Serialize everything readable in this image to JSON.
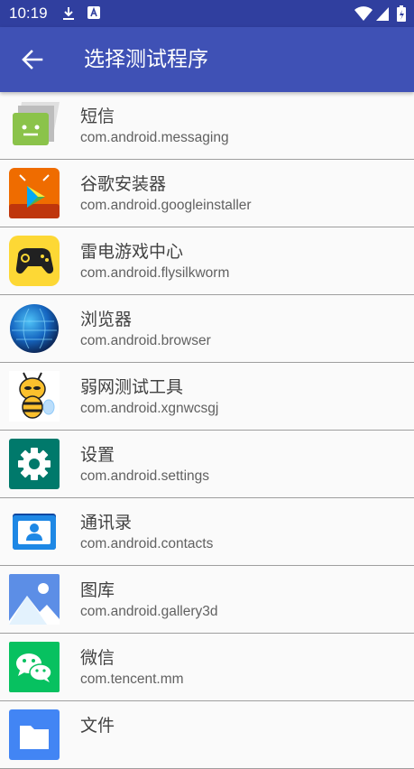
{
  "status_bar": {
    "time": "10:19"
  },
  "app_bar": {
    "title": "选择测试程序"
  },
  "apps": [
    {
      "name": "短信",
      "package": "com.android.messaging",
      "icon": "messaging-icon"
    },
    {
      "name": "谷歌安装器",
      "package": "com.android.googleinstaller",
      "icon": "google-installer-icon"
    },
    {
      "name": "雷电游戏中心",
      "package": "com.android.flysilkworm",
      "icon": "gamepad-icon"
    },
    {
      "name": "浏览器",
      "package": "com.android.browser",
      "icon": "globe-icon"
    },
    {
      "name": "弱网测试工具",
      "package": "com.android.xgnwcsgj",
      "icon": "bee-icon"
    },
    {
      "name": "设置",
      "package": "com.android.settings",
      "icon": "gear-icon"
    },
    {
      "name": "通讯录",
      "package": "com.android.contacts",
      "icon": "contacts-icon"
    },
    {
      "name": "图库",
      "package": "com.android.gallery3d",
      "icon": "gallery-icon"
    },
    {
      "name": "微信",
      "package": "com.tencent.mm",
      "icon": "wechat-icon"
    },
    {
      "name": "文件",
      "package": "",
      "icon": "folder-icon"
    }
  ],
  "colors": {
    "status_bar": "#303f9f",
    "app_bar": "#3f51b5",
    "divider": "#9e9e9e"
  }
}
